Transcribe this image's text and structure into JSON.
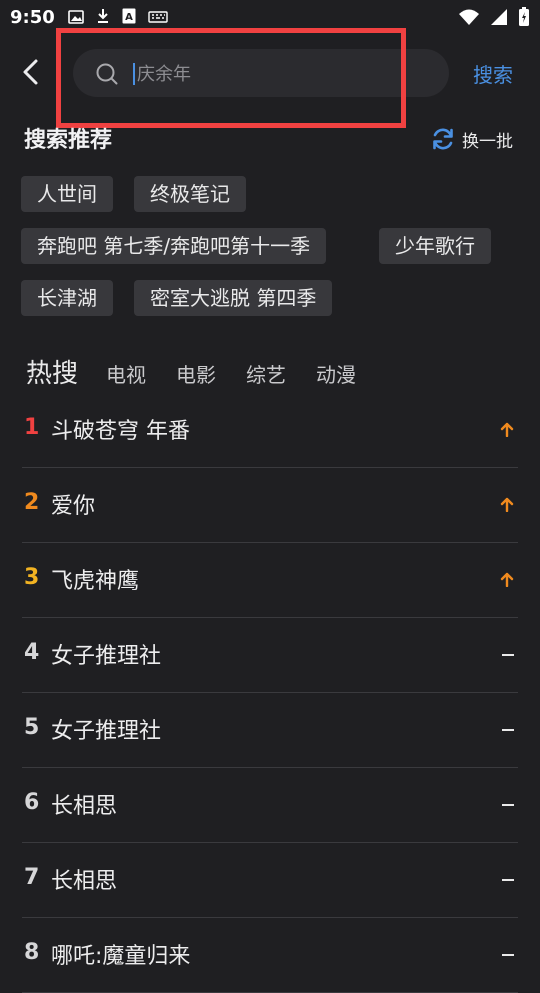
{
  "status_bar": {
    "time": "9:50",
    "left_icons": [
      "image-icon",
      "download-icon",
      "a-icon",
      "keyboard-icon"
    ],
    "right_icons": [
      "wifi-icon",
      "signal-icon",
      "battery-icon"
    ]
  },
  "search": {
    "placeholder": "庆余年",
    "button_label": "搜索",
    "back_icon": "back-arrow-icon"
  },
  "recommend": {
    "title": "搜索推荐",
    "refresh_label": "换一批",
    "tags": [
      "人世间",
      "终极笔记",
      "奔跑吧 第七季/奔跑吧第十一季",
      "少年歌行",
      "长津湖",
      "密室大逃脱 第四季"
    ]
  },
  "hot": {
    "tabs": [
      "热搜",
      "电视",
      "电影",
      "综艺",
      "动漫"
    ],
    "items": [
      {
        "rank": "1",
        "title": "斗破苍穹 年番",
        "trend": "up"
      },
      {
        "rank": "2",
        "title": "爱你",
        "trend": "up"
      },
      {
        "rank": "3",
        "title": "飞虎神鹰",
        "trend": "up"
      },
      {
        "rank": "4",
        "title": "女子推理社",
        "trend": "flat"
      },
      {
        "rank": "5",
        "title": "女子推理社",
        "trend": "flat"
      },
      {
        "rank": "6",
        "title": "长相思",
        "trend": "flat"
      },
      {
        "rank": "7",
        "title": "长相思",
        "trend": "flat"
      },
      {
        "rank": "8",
        "title": "哪吒:魔童归来",
        "trend": "flat"
      }
    ]
  },
  "colors": {
    "background": "#1f1f22",
    "accent_blue": "#4a90e2",
    "rank_1": "#f04141",
    "rank_2": "#f08a1e",
    "rank_3": "#f2b322",
    "rank_other": "#d6d6d8",
    "trend_up": "#f08a1e",
    "highlight_box": "#f04141"
  }
}
